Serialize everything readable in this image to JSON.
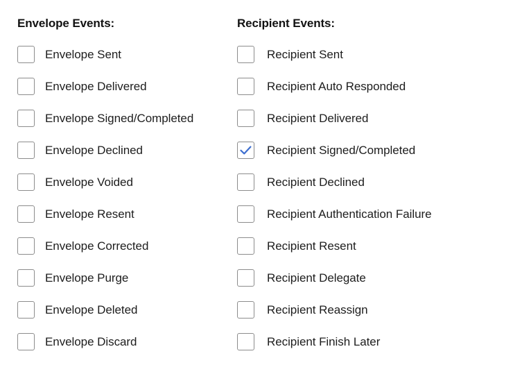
{
  "colors": {
    "background": "#ffffff",
    "text": "#1d1d1d",
    "heading": "#121212",
    "checkbox_border": "#8c8c8c",
    "check_accent": "#3d6ecf"
  },
  "columns": [
    {
      "id": "envelope-events",
      "title": "Envelope Events:",
      "options": [
        {
          "label": "Envelope Sent",
          "checked": false
        },
        {
          "label": "Envelope Delivered",
          "checked": false
        },
        {
          "label": "Envelope Signed/Completed",
          "checked": false
        },
        {
          "label": "Envelope Declined",
          "checked": false
        },
        {
          "label": "Envelope Voided",
          "checked": false
        },
        {
          "label": "Envelope Resent",
          "checked": false
        },
        {
          "label": "Envelope Corrected",
          "checked": false
        },
        {
          "label": "Envelope Purge",
          "checked": false
        },
        {
          "label": "Envelope Deleted",
          "checked": false
        },
        {
          "label": "Envelope Discard",
          "checked": false
        }
      ]
    },
    {
      "id": "recipient-events",
      "title": "Recipient Events:",
      "options": [
        {
          "label": "Recipient Sent",
          "checked": false
        },
        {
          "label": "Recipient Auto Responded",
          "checked": false
        },
        {
          "label": "Recipient Delivered",
          "checked": false
        },
        {
          "label": "Recipient Signed/Completed",
          "checked": true
        },
        {
          "label": "Recipient Declined",
          "checked": false
        },
        {
          "label": "Recipient Authentication Failure",
          "checked": false
        },
        {
          "label": "Recipient Resent",
          "checked": false
        },
        {
          "label": "Recipient Delegate",
          "checked": false
        },
        {
          "label": "Recipient Reassign",
          "checked": false
        },
        {
          "label": "Recipient Finish Later",
          "checked": false
        }
      ]
    }
  ]
}
